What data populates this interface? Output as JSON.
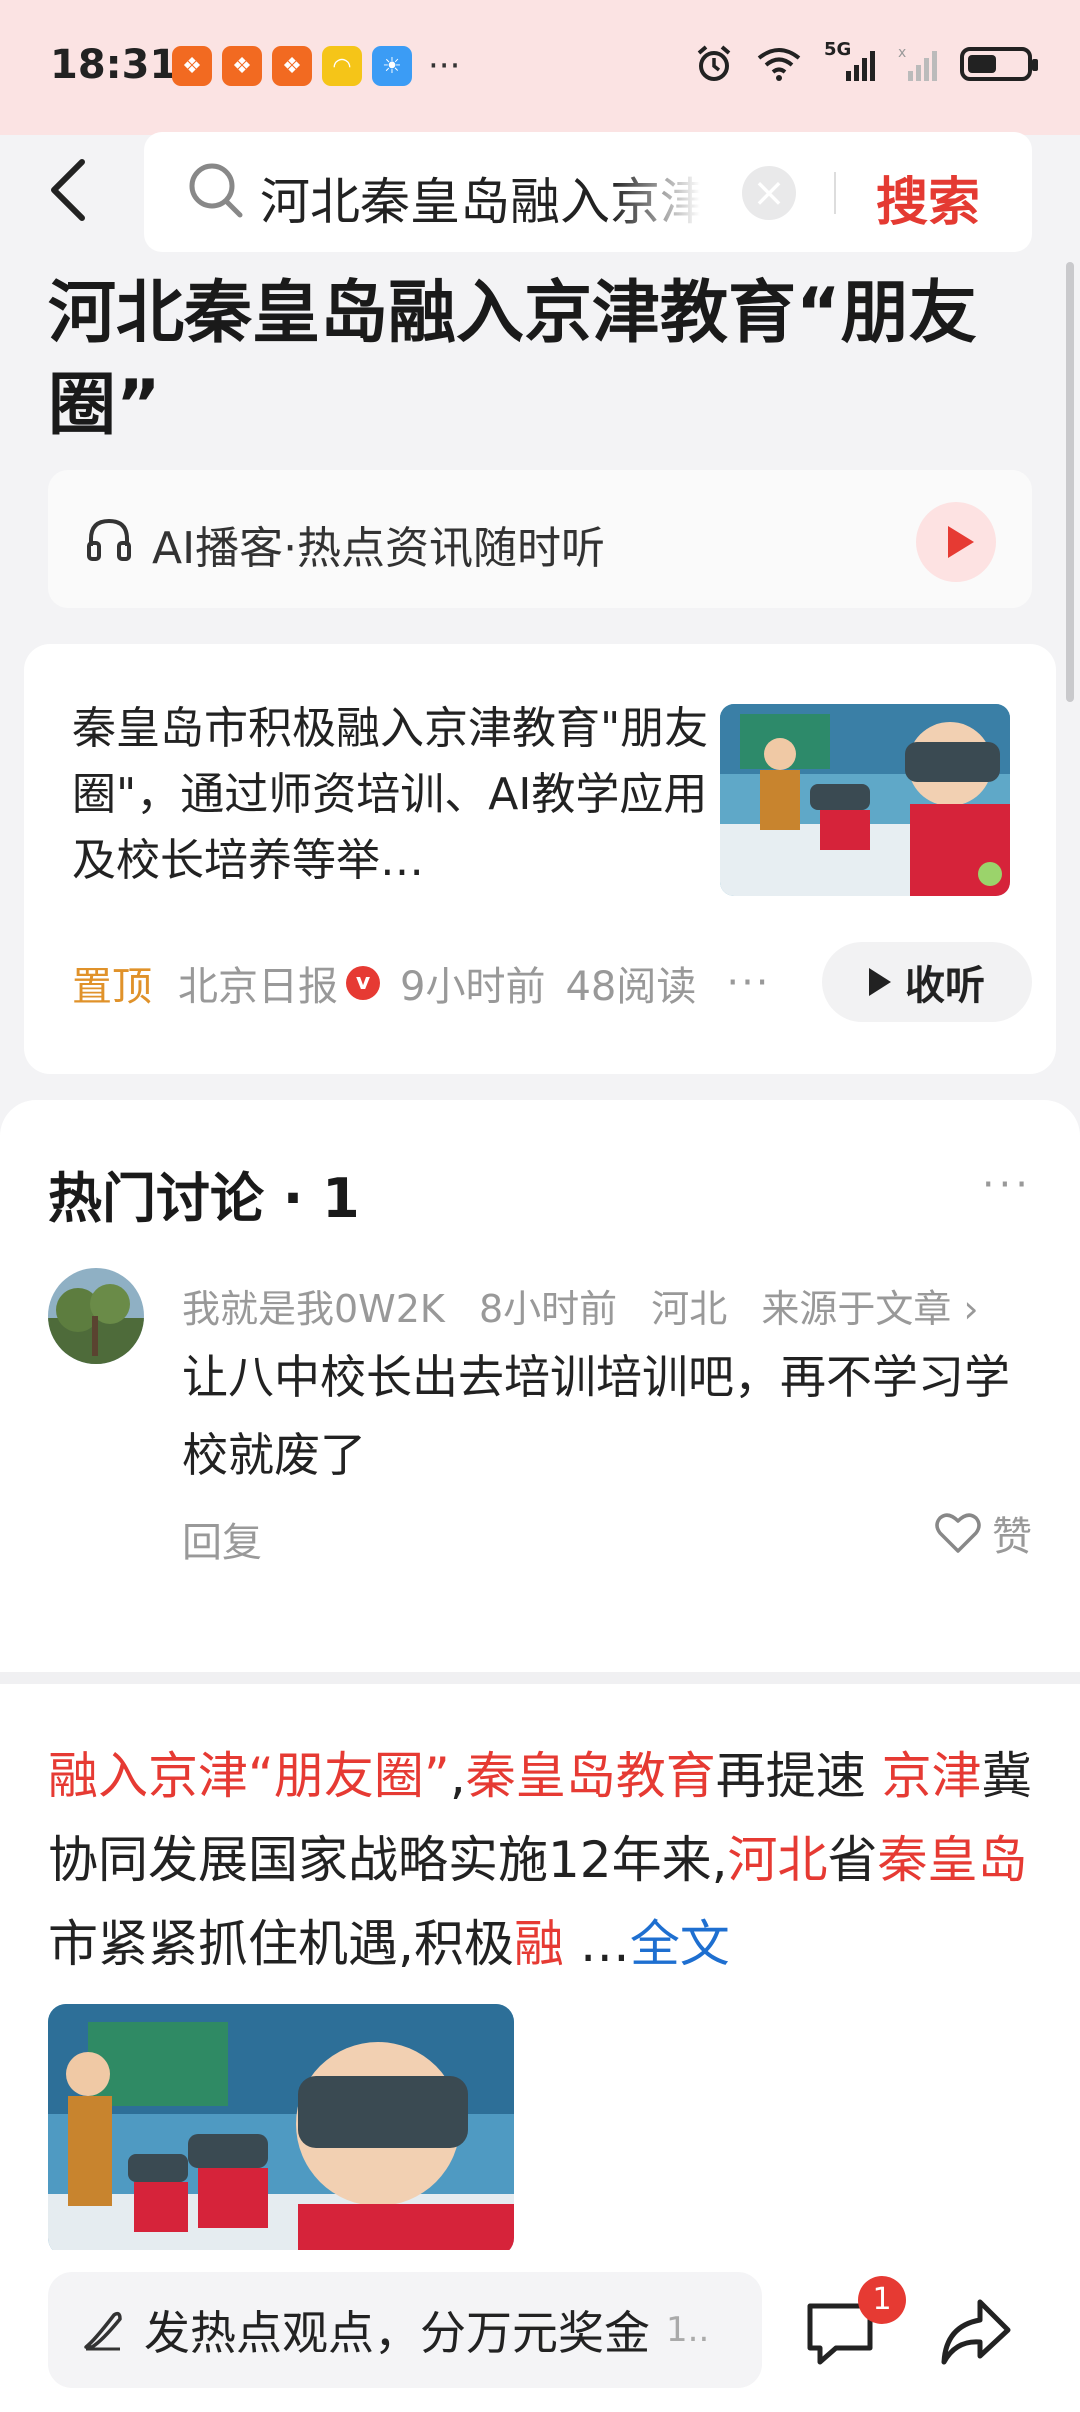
{
  "status_bar": {
    "time": "18:31",
    "app_icons": [
      {
        "name": "app-icon-1",
        "color": "#f26a21",
        "glyph": "❖"
      },
      {
        "name": "app-icon-2",
        "color": "#f26a21",
        "glyph": "❖"
      },
      {
        "name": "app-icon-3",
        "color": "#f26a21",
        "glyph": "❖"
      },
      {
        "name": "app-icon-4",
        "color": "#f5c518",
        "glyph": "◠"
      },
      {
        "name": "app-icon-5",
        "color": "#3b9cf5",
        "glyph": "☀"
      }
    ],
    "more": "···",
    "network": "5G",
    "battery_level": 0.5
  },
  "search": {
    "query": "河北秦皇岛融入京津教育",
    "button_label": "搜索"
  },
  "page": {
    "title": "河北秦皇岛融入京津教育“朋友圈”"
  },
  "podcast": {
    "label": "AI播客·热点资讯随时听"
  },
  "article": {
    "summary": "秦皇岛市积极融入京津教育\"朋友圈\"，通过师资培训、AI教学应用及校长培养等举…",
    "pin": "置顶",
    "source": "北京日报",
    "verified_badge": "v",
    "time": "9小时前",
    "reads": "48阅读",
    "more": "···",
    "listen_label": "收听"
  },
  "discussion": {
    "title": "热门讨论 · 1",
    "more": "···",
    "comment": {
      "user": "我就是我0W2K",
      "time": "8小时前",
      "location": "河北",
      "source_link": "来源于文章 ›",
      "text": "让八中校长出去培训培训吧，再不学习学校就废了",
      "reply_label": "回复",
      "like_label": "赞"
    }
  },
  "related": {
    "segments": [
      {
        "text": "融入京津“朋友圈”",
        "hl": true
      },
      {
        "text": ",",
        "hl": false
      },
      {
        "text": "秦皇岛教育",
        "hl": true
      },
      {
        "text": "再提速 ",
        "hl": false
      },
      {
        "text": "京津",
        "hl": true
      },
      {
        "text": "冀协同发展国家战略实施12年来,",
        "hl": false
      },
      {
        "text": "河北",
        "hl": true
      },
      {
        "text": "省",
        "hl": false
      },
      {
        "text": "秦皇岛",
        "hl": true
      },
      {
        "text": "市紧紧抓住机遇,积极",
        "hl": false
      },
      {
        "text": "融",
        "hl": true
      }
    ],
    "ellipsis": " …",
    "full_text_label": "全文"
  },
  "bottom_bar": {
    "input_text": "发热点观点，分万元奖金",
    "input_suffix": "1..",
    "comment_badge": "1"
  },
  "colors": {
    "accent_red": "#e63a33",
    "link_blue": "#1e6fd0",
    "pin_orange": "#e0922a",
    "status_bg": "#fbe3e3"
  }
}
